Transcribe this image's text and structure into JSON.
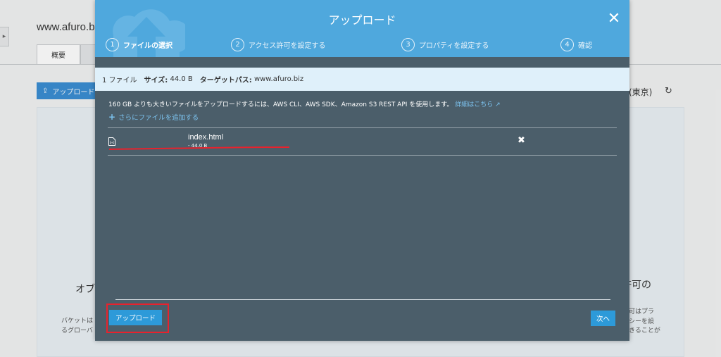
{
  "background": {
    "page_title": "www.afuro.b",
    "tabs": [
      {
        "label": "概要"
      }
    ],
    "upload_button_label": "アップロード",
    "region_label": "(東京)",
    "left_heading": "オブ",
    "left_lines": [
      "バケットは",
      "るグローバ"
    ],
    "right_heading": "許可の",
    "right_lines": [
      "可はプラ",
      "シーを設",
      "きることが"
    ]
  },
  "modal": {
    "title": "アップロード",
    "close_icon": "close-icon",
    "steps": [
      {
        "number": "1",
        "label": "ファイルの選択",
        "active": true
      },
      {
        "number": "2",
        "label": "アクセス許可を設定する",
        "active": false
      },
      {
        "number": "3",
        "label": "プロパティを設定する",
        "active": false
      },
      {
        "number": "4",
        "label": "確認",
        "active": false
      }
    ],
    "info_bar": {
      "file_count": "1 ファイル",
      "size_label": "サイズ:",
      "size_value": "44.0 B",
      "target_label": "ターゲットパス:",
      "target_value": "www.afuro.biz"
    },
    "notice_text": "160 GB よりも大きいファイルをアップロードするには、AWS CLI、AWS SDK、Amazon S3 REST API を使用します。",
    "notice_link": "詳細はこちら",
    "add_more_label": "さらにファイルを追加する",
    "files": [
      {
        "name": "index.html",
        "size": "- 44.0 B",
        "icon": "file-html-icon"
      }
    ],
    "upload_button": "アップロード",
    "next_button": "次へ",
    "colors": {
      "header": "#4fa8dd",
      "body": "#4b5e6a",
      "info_bar": "#dff0fa",
      "button": "#2d9ad9",
      "highlight": "#e8222d",
      "link": "#7cc3ef"
    }
  }
}
